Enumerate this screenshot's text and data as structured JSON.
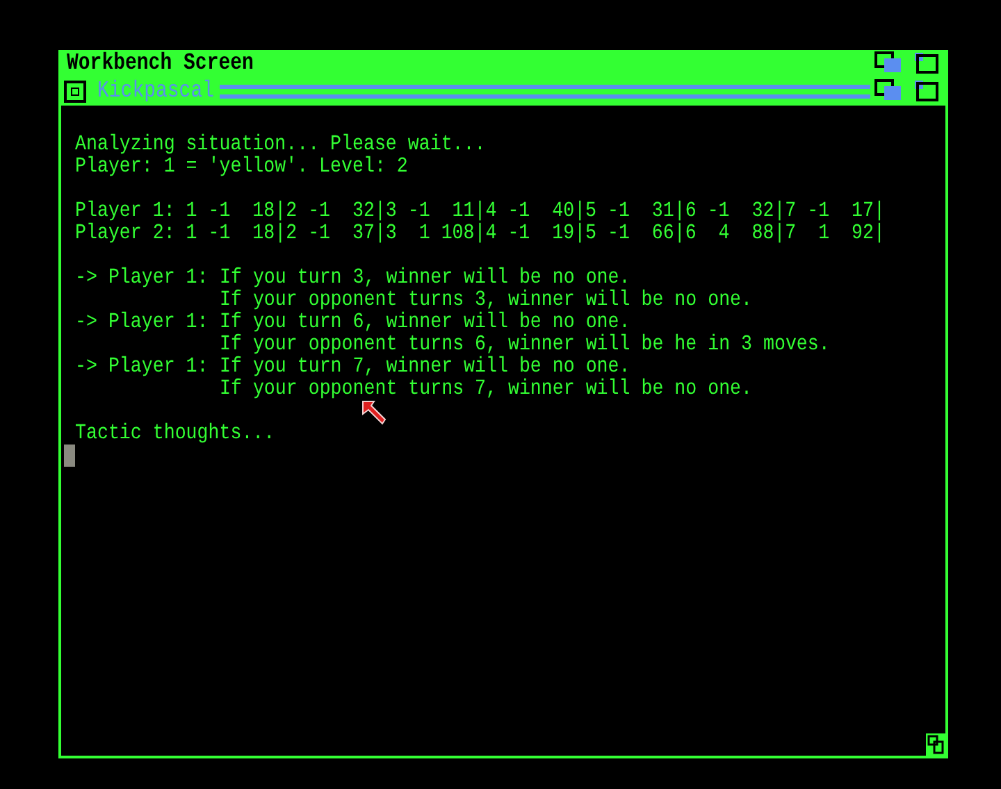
{
  "screen": {
    "title": "Workbench Screen"
  },
  "window": {
    "title": "Kickpascal"
  },
  "console": {
    "header": [
      "Analyzing situation... Please wait...",
      "Player: 1 = 'yellow'. Level: 2"
    ],
    "rows": [
      "Player 1: 1 -1  18|2 -1  32|3 -1  11|4 -1  40|5 -1  31|6 -1  32|7 -1  17|",
      "Player 2: 1 -1  18|2 -1  37|3  1 108|4 -1  19|5 -1  66|6  4  88|7  1  92|"
    ],
    "outcomes": [
      {
        "prefix": "-> Player 1:",
        "lines": [
          "If you turn 3, winner will be no one.",
          "If your opponent turns 3, winner will be no one."
        ]
      },
      {
        "prefix": "-> Player 1:",
        "lines": [
          "If you turn 6, winner will be no one.",
          "If your opponent turns 6, winner will be he in 3 moves."
        ]
      },
      {
        "prefix": "-> Player 1:",
        "lines": [
          "If you turn 7, winner will be no one.",
          "If your opponent turns 7, winner will be no one."
        ]
      }
    ],
    "footer": "Tactic thoughts..."
  }
}
